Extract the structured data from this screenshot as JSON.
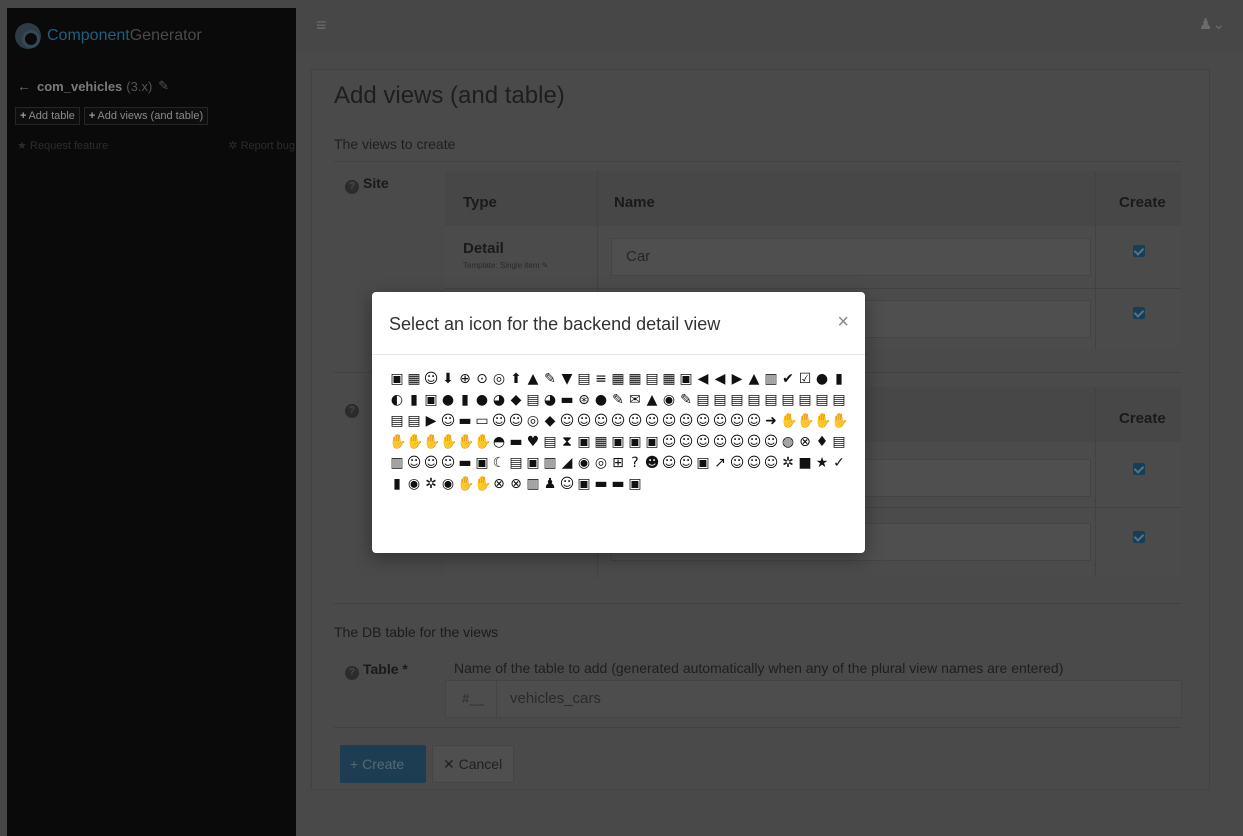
{
  "sidebar": {
    "brand_part1": "Component",
    "brand_part2": "Generator",
    "component_name": "com_vehicles",
    "component_version": "(3.x)",
    "add_table": "Add table",
    "add_views": "Add views (and table)",
    "request_feature": "Request feature",
    "report_bug": "Report bug"
  },
  "page": {
    "title": "Add views (and table)",
    "views_label": "The views to create",
    "site_label": "Site",
    "col_type": "Type",
    "col_name": "Name",
    "col_create": "Create",
    "row1_type": "Detail",
    "row1_template": "Template: Single item",
    "row1_name": "Car",
    "col_create_2": "Create",
    "db_title": "The DB table for the views",
    "table_label": "Table *",
    "table_help": "Name of the table to add (generated automatically when any of the plural view names are entered)",
    "table_prefix": "#__",
    "table_value": "vehicles_cars",
    "create_button": "Create",
    "cancel_button": "Cancel"
  },
  "modal": {
    "title": "Select an icon for the backend detail view",
    "close": "×",
    "icons": [
      "▣",
      "▦",
      "☺",
      "⬇",
      "⊕",
      "⊙",
      "◎",
      "⬆",
      "▲",
      "✎",
      "▼",
      "▤",
      "≡",
      "▦",
      "▦",
      "▤",
      "▦",
      "▣",
      "◀",
      "◀",
      "▶",
      "▲",
      "▥",
      "✔",
      "☑",
      "●",
      "▮",
      "◐",
      "▮",
      "▣",
      "●",
      "▮",
      "●",
      "◕",
      "◆",
      "▤",
      "◕",
      "▬",
      "⊛",
      "●",
      "✎",
      "✉",
      "▲",
      "◉",
      "✎",
      "▤",
      "▤",
      "▤",
      "▤",
      "▤",
      "▤",
      "▤",
      "▤",
      "▤",
      "▤",
      "▤",
      "▶",
      "☺",
      "▬",
      "▭",
      "☺",
      "☺",
      "◎",
      "◆",
      "☺",
      "☺",
      "☺",
      "☺",
      "☺",
      "☺",
      "☺",
      "☺",
      "☺",
      "☺",
      "☺",
      "☺",
      "➜",
      "✋",
      "✋",
      "✋",
      "✋",
      "✋",
      "✋",
      "✋",
      "✋",
      "✋",
      "✋",
      "◓",
      "▬",
      "♥",
      "▤",
      "⧗",
      "▣",
      "▦",
      "▣",
      "▣",
      "▣",
      "☺",
      "☺",
      "☺",
      "☺",
      "☺",
      "☺",
      "☺",
      "◍",
      "⊗",
      "♦",
      "▤",
      "▥",
      "☺",
      "☺",
      "☺",
      "▬",
      "▣",
      "☾",
      "▤",
      "▣",
      "▥",
      "◢",
      "◉",
      "◎",
      "⊞",
      "?",
      "☻",
      "☺",
      "☺",
      "▣",
      "↗",
      "☺",
      "☺",
      "☺",
      "✲",
      "■",
      "★",
      "✓",
      "▮",
      "◉",
      "✲",
      "◉",
      "✋",
      "✋",
      "⊗",
      "⊗",
      "▥",
      "♟",
      "☺",
      "▣",
      "▬",
      "▬",
      "▣"
    ]
  }
}
